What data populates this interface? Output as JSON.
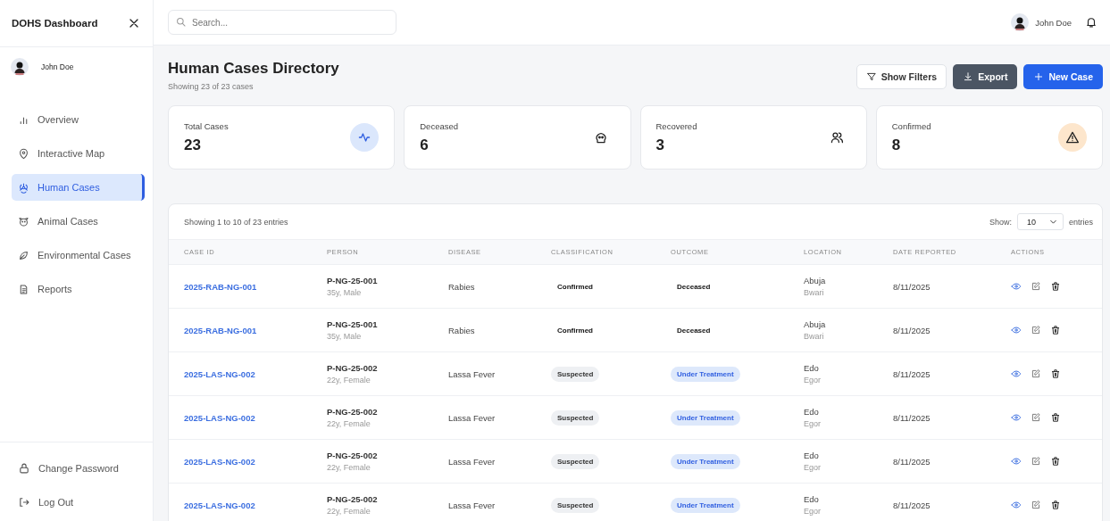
{
  "sidebar": {
    "title": "DOHS Dashboard",
    "user": "John Doe",
    "nav": [
      {
        "label": "Overview",
        "selected": false
      },
      {
        "label": "Interactive Map",
        "selected": false
      },
      {
        "label": "Human Cases",
        "selected": true
      },
      {
        "label": "Animal Cases",
        "selected": false
      },
      {
        "label": "Environmental Cases",
        "selected": false
      },
      {
        "label": "Reports",
        "selected": false
      }
    ],
    "footer": [
      {
        "label": "Change Password"
      },
      {
        "label": "Log Out"
      }
    ]
  },
  "topbar": {
    "search": {
      "placeholder": "Search..."
    },
    "user": "John Doe"
  },
  "header": {
    "title": "Human Cases Directory",
    "subtitle": "Showing 23 of 23 cases",
    "buttons": [
      {
        "label": "Show Filters",
        "kind": "outline"
      },
      {
        "label": "Export",
        "kind": "dark"
      },
      {
        "label": "New Case",
        "kind": "primary"
      }
    ]
  },
  "stats": [
    {
      "label": "Total Cases",
      "value": "23"
    },
    {
      "label": "Deceased",
      "value": "6"
    },
    {
      "label": "Recovered",
      "value": "3"
    },
    {
      "label": "Confirmed",
      "value": "8"
    }
  ],
  "table": {
    "summary": "Showing 1 to 10 of 23 entries",
    "show_label": "Show:",
    "page_size": "10",
    "entries_label": "entries",
    "columns": [
      "CASE ID",
      "PERSON",
      "DISEASE",
      "CLASSIFICATION",
      "OUTCOME",
      "LOCATION",
      "DATE REPORTED",
      "ACTIONS"
    ],
    "rows": [
      {
        "case_id": "2025-RAB-NG-001",
        "person": "P-NG-25-001",
        "person_detail": "35y, Male",
        "disease": "Rabies",
        "classification": {
          "label": "Confirmed",
          "kind": "plain"
        },
        "outcome": {
          "label": "Deceased",
          "kind": "plain"
        },
        "location": "Abuja",
        "area": "Bwari",
        "date": "8/11/2025"
      },
      {
        "case_id": "2025-RAB-NG-001",
        "person": "P-NG-25-001",
        "person_detail": "35y, Male",
        "disease": "Rabies",
        "classification": {
          "label": "Confirmed",
          "kind": "plain"
        },
        "outcome": {
          "label": "Deceased",
          "kind": "plain"
        },
        "location": "Abuja",
        "area": "Bwari",
        "date": "8/11/2025"
      },
      {
        "case_id": "2025-LAS-NG-002",
        "person": "P-NG-25-002",
        "person_detail": "22y, Female",
        "disease": "Lassa Fever",
        "classification": {
          "label": "Suspected",
          "kind": "grey"
        },
        "outcome": {
          "label": "Under Treatment",
          "kind": "blue"
        },
        "location": "Edo",
        "area": "Egor",
        "date": "8/11/2025"
      },
      {
        "case_id": "2025-LAS-NG-002",
        "person": "P-NG-25-002",
        "person_detail": "22y, Female",
        "disease": "Lassa Fever",
        "classification": {
          "label": "Suspected",
          "kind": "grey"
        },
        "outcome": {
          "label": "Under Treatment",
          "kind": "blue"
        },
        "location": "Edo",
        "area": "Egor",
        "date": "8/11/2025"
      },
      {
        "case_id": "2025-LAS-NG-002",
        "person": "P-NG-25-002",
        "person_detail": "22y, Female",
        "disease": "Lassa Fever",
        "classification": {
          "label": "Suspected",
          "kind": "grey"
        },
        "outcome": {
          "label": "Under Treatment",
          "kind": "blue"
        },
        "location": "Edo",
        "area": "Egor",
        "date": "8/11/2025"
      },
      {
        "case_id": "2025-LAS-NG-002",
        "person": "P-NG-25-002",
        "person_detail": "22y, Female",
        "disease": "Lassa Fever",
        "classification": {
          "label": "Suspected",
          "kind": "grey"
        },
        "outcome": {
          "label": "Under Treatment",
          "kind": "blue"
        },
        "location": "Edo",
        "area": "Egor",
        "date": "8/11/2025"
      }
    ]
  }
}
